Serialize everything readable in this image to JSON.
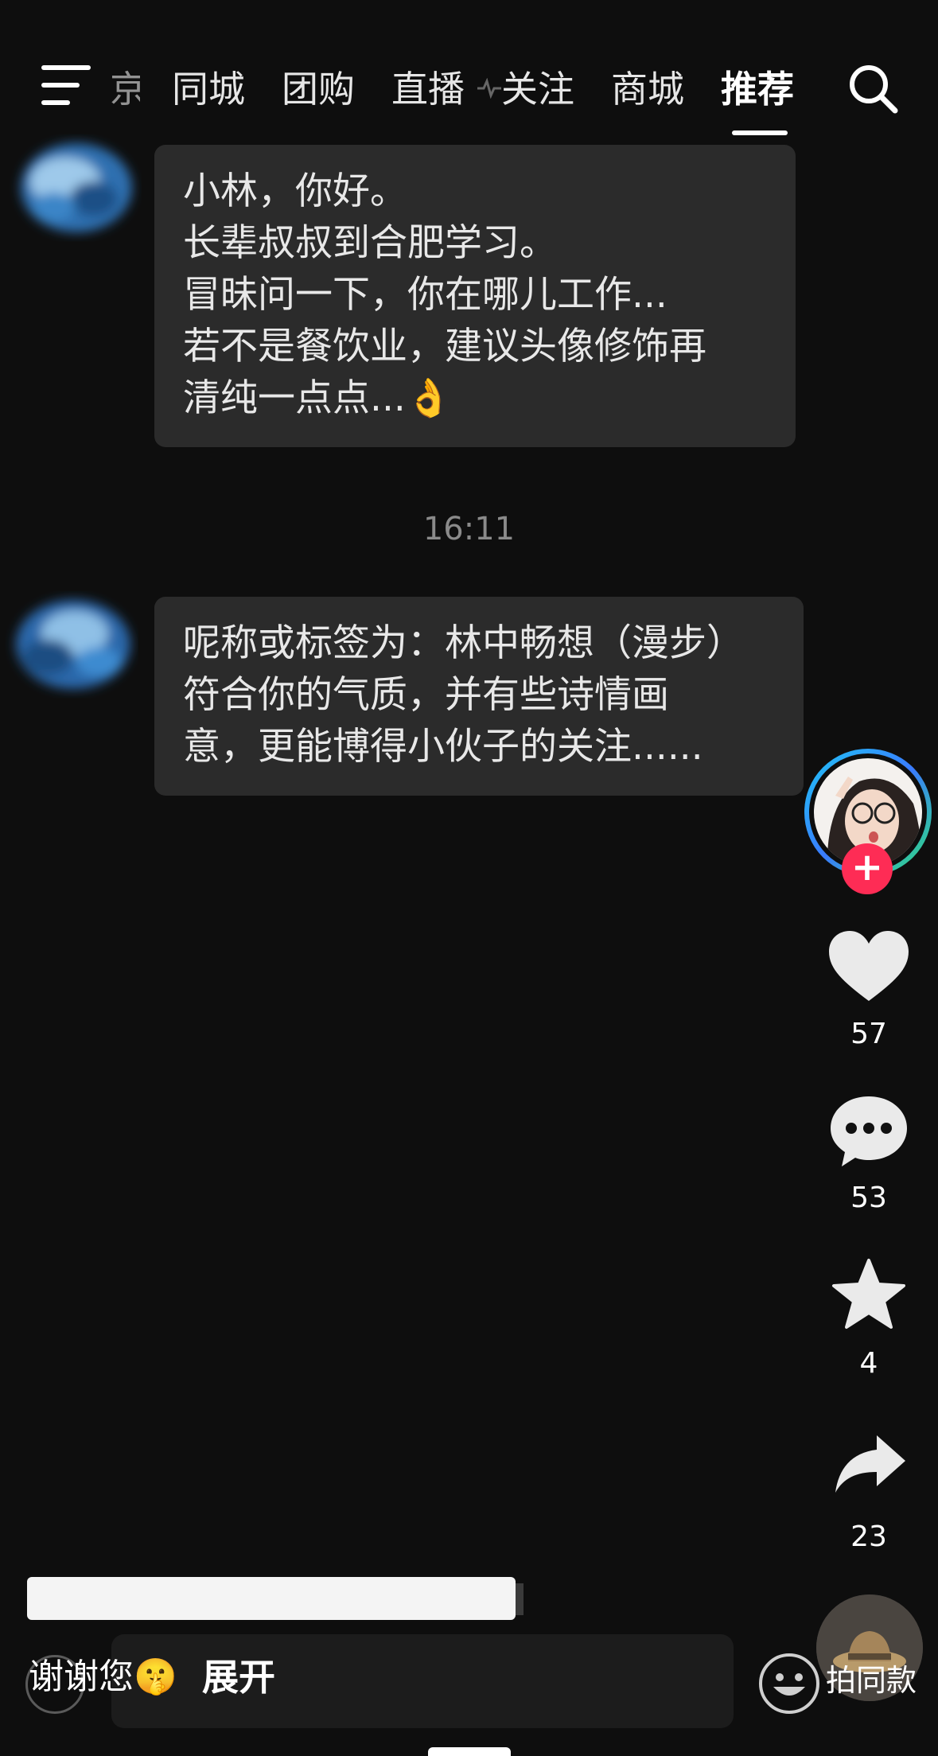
{
  "nav": {
    "tabs": [
      "同城",
      "团购",
      "直播",
      "关注",
      "商城",
      "推荐"
    ],
    "faded_tab_fragment": "京",
    "active_tab": "推荐"
  },
  "chat": {
    "message1": [
      "小林，你好。",
      "长辈叔叔到合肥学习。",
      "冒昧问一下，你在哪儿工作...",
      "若不是餐饮业，建议头像修饰再",
      "清纯一点点...👌"
    ],
    "timestamp": "16:11",
    "message2": [
      "呢称或标签为：林中畅想（漫步）",
      "符合你的气质，并有些诗情画",
      "意，更能博得小伙子的关注......"
    ]
  },
  "rail": {
    "likes": "57",
    "comments": "53",
    "favorites": "4",
    "shares": "23",
    "follow_symbol": "+"
  },
  "bottom": {
    "caption": "谢谢您🤫",
    "expand": "展开",
    "same_style": "拍同款"
  },
  "colors": {
    "background": "#0e0e0e",
    "bubble": "#2b2b2b",
    "follow": "#fe2c55",
    "timestamp": "#8a8a8a"
  },
  "icons": [
    "menu-icon",
    "search-icon",
    "heart-icon",
    "comment-icon",
    "star-icon",
    "share-icon",
    "smile-icon",
    "music-disc-icon"
  ]
}
